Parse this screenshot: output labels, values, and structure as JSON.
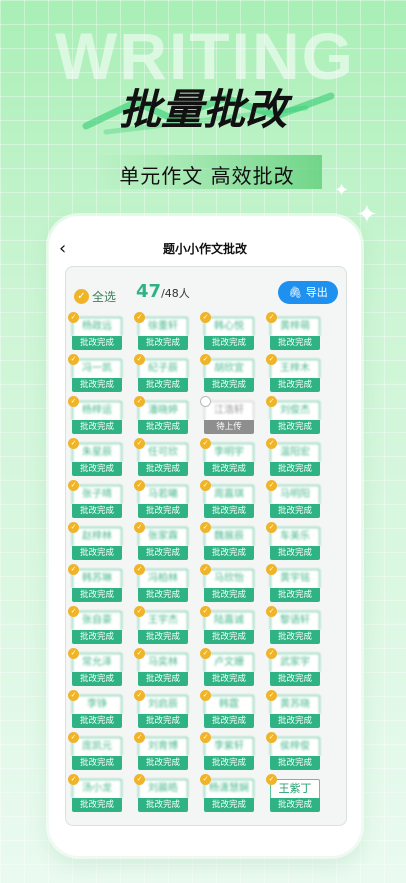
{
  "hero": {
    "bg_word": "WRITING",
    "headline": "批量批改",
    "subline": "单元作文 高效批改"
  },
  "app": {
    "nav": {
      "back_icon": "chevron-left-icon",
      "title": "题小小作文批改"
    },
    "toolbar": {
      "select_all_label": "全选",
      "selected_count": "47",
      "total_count": "/48人",
      "export_label": "导出"
    },
    "status_done": "批改完成",
    "status_pending": "待上传",
    "students": [
      {
        "name": "杨政远",
        "status": "done"
      },
      {
        "name": "徐重轩",
        "status": "done"
      },
      {
        "name": "韩心悦",
        "status": "done"
      },
      {
        "name": "黄梓萌",
        "status": "done"
      },
      {
        "name": "冯一凯",
        "status": "done"
      },
      {
        "name": "纪子辰",
        "status": "done"
      },
      {
        "name": "胡欣宜",
        "status": "done"
      },
      {
        "name": "王梓木",
        "status": "done"
      },
      {
        "name": "杨梓运",
        "status": "done"
      },
      {
        "name": "潘晓婷",
        "status": "done"
      },
      {
        "name": "江浩轩",
        "status": "pending"
      },
      {
        "name": "刘俊杰",
        "status": "done"
      },
      {
        "name": "朱星辰",
        "status": "done"
      },
      {
        "name": "任可欣",
        "status": "done"
      },
      {
        "name": "李明宇",
        "status": "done"
      },
      {
        "name": "温阳宏",
        "status": "done"
      },
      {
        "name": "张子晴",
        "status": "done"
      },
      {
        "name": "马若曦",
        "status": "done"
      },
      {
        "name": "周嘉琪",
        "status": "done"
      },
      {
        "name": "马明阳",
        "status": "done"
      },
      {
        "name": "赵梓林",
        "status": "done"
      },
      {
        "name": "张家霖",
        "status": "done"
      },
      {
        "name": "魏展辰",
        "status": "done"
      },
      {
        "name": "车美乐",
        "status": "done"
      },
      {
        "name": "韩苏琳",
        "status": "done"
      },
      {
        "name": "冯柏林",
        "status": "done"
      },
      {
        "name": "马欣怡",
        "status": "done"
      },
      {
        "name": "黄宇铭",
        "status": "done"
      },
      {
        "name": "张自豪",
        "status": "done"
      },
      {
        "name": "王宇杰",
        "status": "done"
      },
      {
        "name": "陆嘉诚",
        "status": "done"
      },
      {
        "name": "黎语轩",
        "status": "done"
      },
      {
        "name": "常允泽",
        "status": "done"
      },
      {
        "name": "马奕林",
        "status": "done"
      },
      {
        "name": "卢文姗",
        "status": "done"
      },
      {
        "name": "武家宇",
        "status": "done"
      },
      {
        "name": "李铮",
        "status": "done"
      },
      {
        "name": "刘启辰",
        "status": "done"
      },
      {
        "name": "韩霆",
        "status": "done"
      },
      {
        "name": "黄苏晓",
        "status": "done"
      },
      {
        "name": "庞凯元",
        "status": "done"
      },
      {
        "name": "刘育博",
        "status": "done"
      },
      {
        "name": "李紫轩",
        "status": "done"
      },
      {
        "name": "侯梓俊",
        "status": "done"
      },
      {
        "name": "汤小龙",
        "status": "done"
      },
      {
        "name": "刘晨皓",
        "status": "done"
      },
      {
        "name": "杨潇慧娴",
        "status": "done"
      },
      {
        "name": "王紫丁",
        "status": "done",
        "clear": true
      }
    ]
  }
}
